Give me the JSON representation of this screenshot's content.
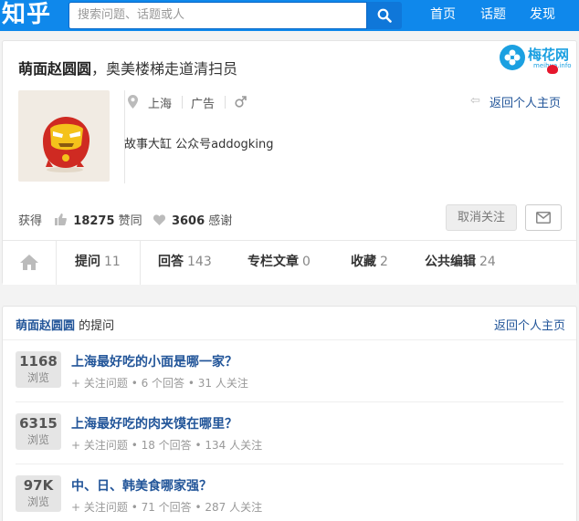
{
  "topbar": {
    "logo": "知乎",
    "search_placeholder": "搜索问题、话题或人",
    "nav": [
      "首页",
      "话题",
      "发现"
    ]
  },
  "watermark": {
    "text": "梅花网",
    "sub": "meihua.info"
  },
  "profile": {
    "name": "萌面赵圆圆",
    "bio": "，奥美楼梯走道清扫员",
    "location": "上海",
    "industry": "广告",
    "gender_icon": "male-icon",
    "back_link": "返回个人主页",
    "description": "故事大缸 公众号addogking",
    "stats": {
      "prefix": "获得",
      "upvotes": "18275",
      "upvotes_label": "赞同",
      "thanks": "3606",
      "thanks_label": "感谢"
    },
    "unfollow_label": "取消关注"
  },
  "tabs": [
    {
      "label": "提问",
      "count": "11"
    },
    {
      "label": "回答",
      "count": "143"
    },
    {
      "label": "专栏文章",
      "count": "0"
    },
    {
      "label": "收藏",
      "count": "2"
    },
    {
      "label": "公共编辑",
      "count": "24"
    }
  ],
  "questions_section": {
    "owner": "萌面赵圆圆",
    "title_suffix": " 的提问",
    "back_link": "返回个人主页",
    "items": [
      {
        "views": "1168",
        "views_label": "浏览",
        "title": "上海最好吃的小面是哪一家？",
        "follow": "+ 关注问题",
        "answers": "6 个回答",
        "followers": "31 人关注"
      },
      {
        "views": "6315",
        "views_label": "浏览",
        "title": "上海最好吃的肉夹馍在哪里？",
        "follow": "+ 关注问题",
        "answers": "18 个回答",
        "followers": "134 人关注"
      },
      {
        "views": "97K",
        "views_label": "浏览",
        "title": "中、日、韩美食哪家强？",
        "follow": "+ 关注问题",
        "answers": "71 个回答",
        "followers": "287 人关注"
      }
    ]
  },
  "colors": {
    "brand": "#0f88eb",
    "link": "#225599"
  }
}
